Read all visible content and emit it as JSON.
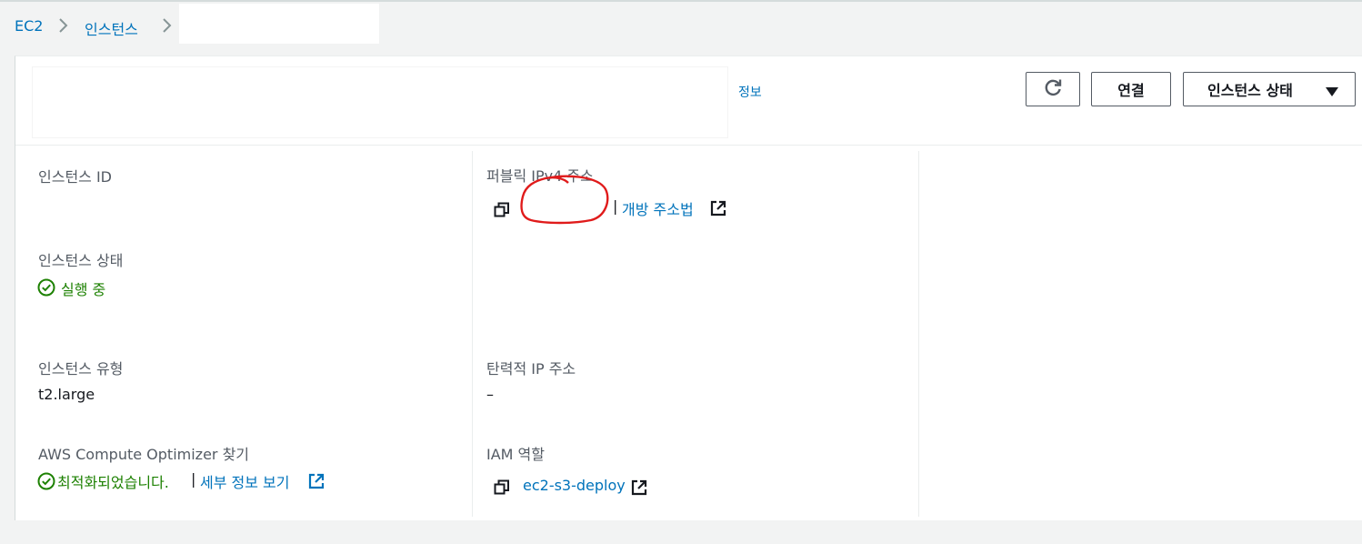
{
  "breadcrumb": {
    "items": [
      {
        "label": "EC2"
      },
      {
        "label": "인스턴스"
      }
    ],
    "current": ""
  },
  "header": {
    "title": "",
    "info_link": "정보",
    "buttons": {
      "refresh_icon": "refresh-icon",
      "connect": "연결",
      "instance_state": "인스턴스 상태"
    }
  },
  "details": {
    "instance_id": {
      "label": "인스턴스 ID",
      "value": ""
    },
    "public_ipv4": {
      "label": "퍼블릭 IPv4 주소",
      "value": "",
      "separator": "|",
      "open_address_link": "개방 주소법"
    },
    "instance_state": {
      "label": "인스턴스 상태",
      "value": "실행 중"
    },
    "instance_type": {
      "label": "인스턴스 유형",
      "value": "t2.large"
    },
    "elastic_ip": {
      "label": "탄력적 IP 주소",
      "value": "–"
    },
    "compute_optimizer": {
      "label": "AWS Compute Optimizer 찾기",
      "status": "최적화되었습니다.",
      "separator": "|",
      "details_link": "세부 정보 보기"
    },
    "iam_role": {
      "label": "IAM 역할",
      "value": "ec2-s3-deploy"
    }
  },
  "colors": {
    "link": "#0073bb",
    "success": "#1d8102",
    "annotation": "#e01b1b"
  }
}
